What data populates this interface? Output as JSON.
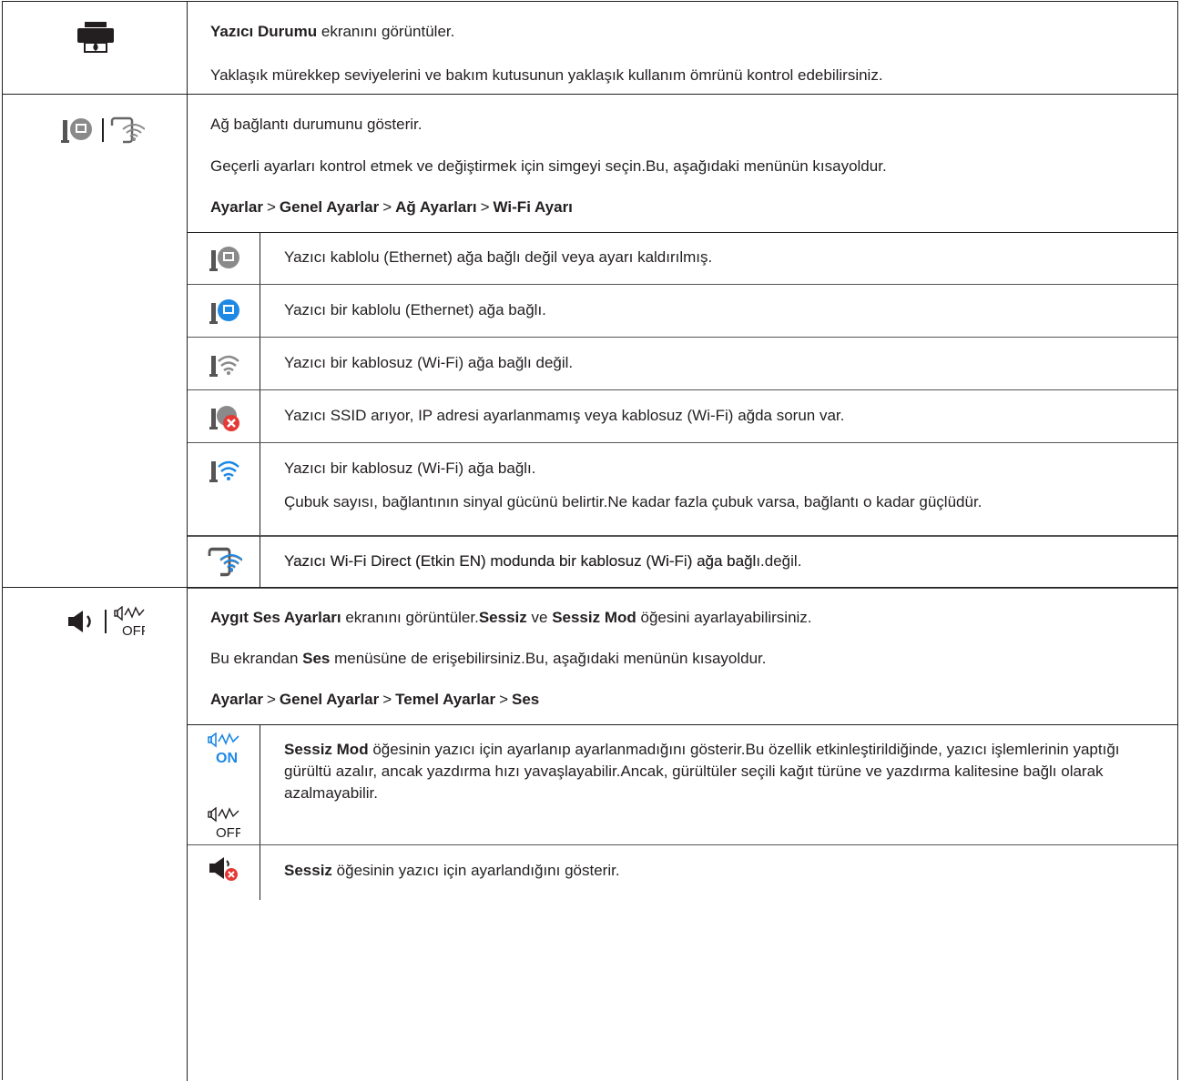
{
  "row1": {
    "icon": "printer-ink-icon",
    "line1": {
      "bold": "Yazıcı Durumu",
      "rest": " ekranını görüntüler."
    },
    "line2": "Yaklaşık mürekkep seviyelerini ve bakım kutusunun yaklaşık kullanım ömrünü kontrol edebilirsiniz."
  },
  "row2": {
    "icons": [
      "wired-network-icon",
      "wifi-direct-icon"
    ],
    "line1": "Ağ bağlantı durumunu gösterir.",
    "line2": "Geçerli ayarları kontrol etmek ve değiştirmek için simgeyi seçin.Bu, aşağıdaki menünün kısayoldur.",
    "path": [
      "Ayarlar",
      "Genel Ayarlar",
      "Ağ Ayarları",
      "Wi-Fi Ayarı"
    ],
    "path_sep": ">",
    "items": [
      {
        "icon": "wired-disconnected-icon",
        "text": "Yazıcı kablolu (Ethernet) ağa bağlı değil veya ayarı kaldırılmış."
      },
      {
        "icon": "wired-connected-icon",
        "text": "Yazıcı bir kablolu (Ethernet) ağa bağlı."
      },
      {
        "icon": "wifi-disconnected-icon",
        "text": "Yazıcı bir kablosuz (Wi-Fi) ağa bağlı değil."
      },
      {
        "icon": "wifi-error-icon",
        "text": "Yazıcı SSID arıyor, IP adresi ayarlanmamış veya kablosuz (Wi-Fi) ağda sorun var."
      },
      {
        "icon": "wifi-connected-icon",
        "text": "Yazıcı bir kablosuz (Wi-Fi) ağa bağlı.",
        "text2": "Çubuk sayısı, bağlantının sinyal gücünü belirtir.Ne kadar fazla çubuk varsa, bağlantı o kadar güçlüdür."
      },
      {
        "icon": "wifi-direct-disconnected-icon",
        "text": "Yazıcı Wi-Fi Direct (Etkin EN) modunda bir kablosuz (Wi-Fi) ağa bağlı değil."
      },
      {
        "icon": "wifi-direct-connected-icon",
        "text": "Yazıcı Wi-Fi Direct (Etkin EN) modunda bir kablosuz (Wi-Fi) ağa bağlı."
      }
    ]
  },
  "row3": {
    "icons": [
      "speaker-icon",
      "quiet-off-icon"
    ],
    "line1": {
      "b1": "Aygıt Ses Ayarları",
      "t1": " ekranını görüntüler.",
      "b2": "Sessiz",
      "t2": " ve ",
      "b3": "Sessiz Mod",
      "t3": " öğesini ayarlayabilirsiniz."
    },
    "line2": {
      "t1": "Bu ekrandan ",
      "b1": "Ses",
      "t2": " menüsüne de erişebilirsiniz.Bu, aşağıdaki menünün kısayoldur."
    },
    "path": [
      "Ayarlar",
      "Genel Ayarlar",
      "Temel Ayarlar",
      "Ses"
    ],
    "path_sep": ">",
    "items": [
      {
        "icons": [
          "quiet-on-icon",
          "quiet-off-icon"
        ],
        "on_label": "ON",
        "off_label": "OFF",
        "bold": "Sessiz Mod",
        "text": " öğesinin yazıcı için ayarlanıp ayarlanmadığını gösterir.Bu özellik etkinleştirildiğinde, yazıcı işlemlerinin yaptığı gürültü azalır, ancak yazdırma hızı yavaşlayabilir.Ancak, gürültüler seçili kağıt türüne ve yazdırma kalitesine bağlı olarak azalmayabilir."
      },
      {
        "icon": "mute-icon",
        "bold": "Sessiz",
        "text": " öğesinin yazıcı için ayarlandığını gösterir."
      }
    ]
  },
  "colors": {
    "line": "#231f20",
    "wifi_blue": "#1e88e5",
    "error_red": "#e53935",
    "gray_icon": "#8a8a8a"
  }
}
